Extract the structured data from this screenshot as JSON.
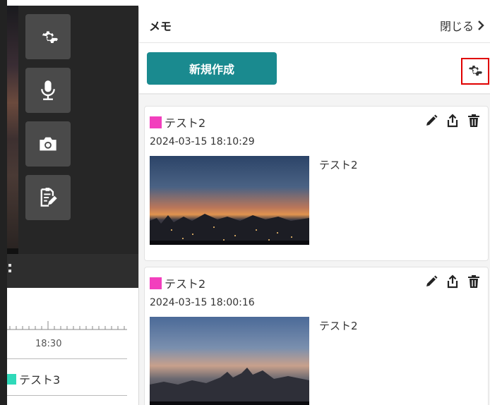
{
  "panel": {
    "title": "メモ",
    "close_label": "閉じる"
  },
  "toolbar": {
    "new_label": "新規作成",
    "settings_icon": "gear-icon"
  },
  "left_tools": [
    "gear-icon",
    "microphone-icon",
    "camera-icon",
    "memo-edit-icon"
  ],
  "timeline": {
    "tick_label": "18:30",
    "item_label": "テスト3",
    "item_color": "#2fd9b9"
  },
  "memos": [
    {
      "title": "テスト2",
      "datetime": "2024-03-15 18:10:29",
      "body": "テスト2",
      "color": "#f23fbd"
    },
    {
      "title": "テスト2",
      "datetime": "2024-03-15 18:00:16",
      "body": "テスト2",
      "color": "#f23fbd"
    }
  ],
  "colors": {
    "accent": "#1a8a8f",
    "highlight": "#e00000"
  }
}
